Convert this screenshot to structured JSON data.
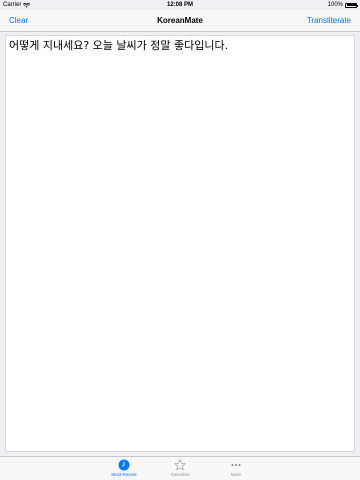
{
  "status_bar": {
    "carrier": "Carrier",
    "time": "12:08 PM",
    "battery_percent": "100%",
    "battery_level": 1.0
  },
  "nav": {
    "left_label": "Clear",
    "title": "KoreanMate",
    "right_label": "Transliterate"
  },
  "editor": {
    "text": "어떻게 지내세요? 오늘 날씨가 정말 좋다입니다."
  },
  "tabs": [
    {
      "label": "Most Recent",
      "icon": "clock-icon",
      "active": true
    },
    {
      "label": "Favorites",
      "icon": "star-icon",
      "active": false
    },
    {
      "label": "More",
      "icon": "more-icon",
      "active": false
    }
  ],
  "colors": {
    "accent": "#007aff",
    "inactive": "#929292",
    "background": "#efeff4"
  }
}
